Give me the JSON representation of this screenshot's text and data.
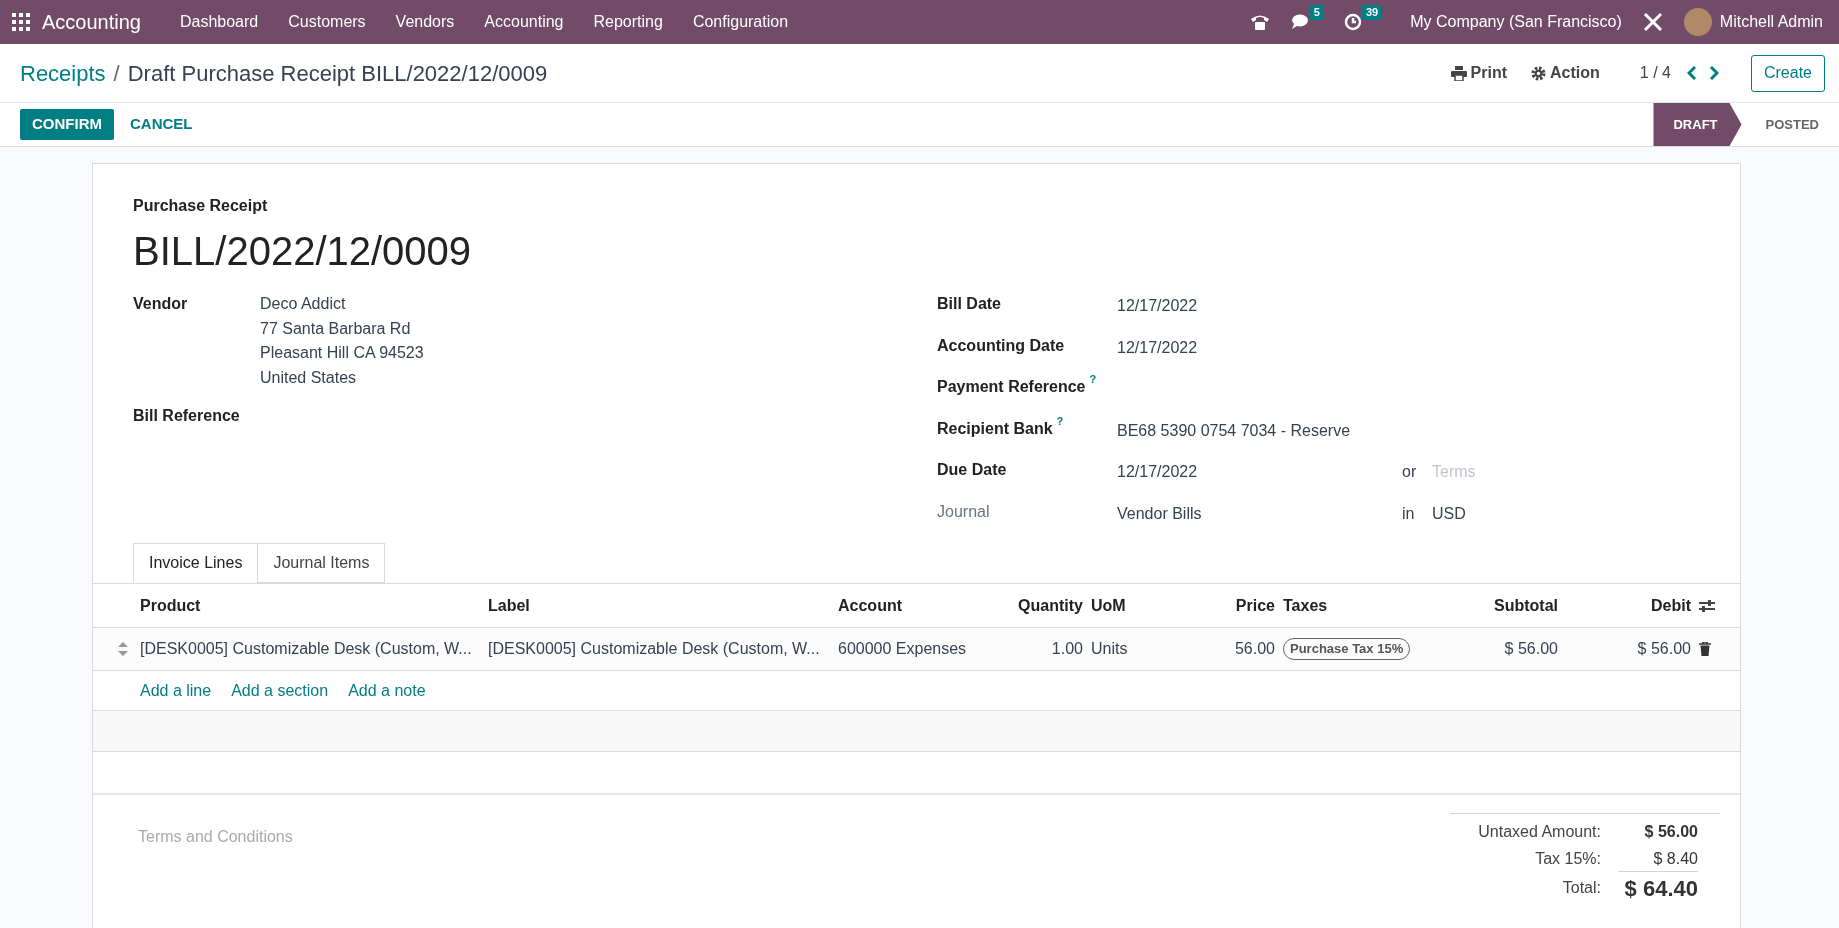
{
  "navbar": {
    "app_name": "Accounting",
    "menu": [
      "Dashboard",
      "Customers",
      "Vendors",
      "Accounting",
      "Reporting",
      "Configuration"
    ],
    "messages_count": "5",
    "activities_count": "39",
    "company": "My Company (San Francisco)",
    "user": "Mitchell Admin"
  },
  "breadcrumb": {
    "parent": "Receipts",
    "separator": "/",
    "current": "Draft Purchase Receipt BILL/2022/12/0009"
  },
  "toolbar": {
    "print": "Print",
    "action": "Action",
    "pager": "1 / 4",
    "create": "Create"
  },
  "actions": [
    {
      "label": "CONFIRM",
      "kind": "primary"
    },
    {
      "label": "CANCEL",
      "kind": "secondary"
    }
  ],
  "status_steps": [
    {
      "label": "DRAFT",
      "selected": true
    },
    {
      "label": "POSTED",
      "selected": false
    }
  ],
  "form": {
    "type_label": "Purchase Receipt",
    "number": "BILL/2022/12/0009",
    "left_fields": [
      {
        "label": "Vendor",
        "lines": [
          "Deco Addict",
          "77 Santa Barbara Rd",
          "Pleasant Hill CA 94523",
          "United States"
        ]
      },
      {
        "label": "Bill Reference"
      }
    ],
    "right_fields": [
      {
        "label": "Bill Date",
        "value": "12/17/2022",
        "muted": false
      },
      {
        "label": "Accounting Date",
        "value": "12/17/2022",
        "muted": false
      },
      {
        "label": "Payment Reference",
        "help": "?",
        "muted": false
      },
      {
        "label": "Recipient Bank",
        "help": "?",
        "value": "BE68 5390 0754 7034 - Reserve",
        "muted": false
      },
      {
        "label": "Due Date",
        "value": "12/17/2022",
        "joiner": "or",
        "placeholder": "Terms",
        "muted": false
      },
      {
        "label": "Journal",
        "value": "Vendor Bills",
        "joiner": "in",
        "extra_value": "USD",
        "muted": true
      }
    ]
  },
  "tabs": [
    {
      "label": "Invoice Lines",
      "selected": true
    },
    {
      "label": "Journal Items",
      "selected": false
    }
  ],
  "table": {
    "columns": [
      "Product",
      "Label",
      "Account",
      "Quantity",
      "UoM",
      "Price",
      "Taxes",
      "Subtotal",
      "Debit"
    ],
    "rows": [
      {
        "product": "[DESK0005] Customizable Desk (Custom, W...",
        "label": "[DESK0005] Customizable Desk (Custom, W...",
        "account": "600000 Expenses",
        "quantity": "1.00",
        "uom": "Units",
        "price": "56.00",
        "taxes": [
          "Purchase Tax 15%"
        ],
        "subtotal": "$ 56.00",
        "debit": "$ 56.00"
      }
    ],
    "add_links": [
      "Add a line",
      "Add a section",
      "Add a note"
    ]
  },
  "terms_placeholder": "Terms and Conditions",
  "totals": [
    {
      "label": "Untaxed Amount:",
      "value": "$ 56.00",
      "kind": "bold"
    },
    {
      "label": "Tax 15%:",
      "value": "$ 8.40",
      "kind": "plain"
    },
    {
      "label": "Total:",
      "value": "$ 64.40",
      "kind": "grand"
    }
  ]
}
